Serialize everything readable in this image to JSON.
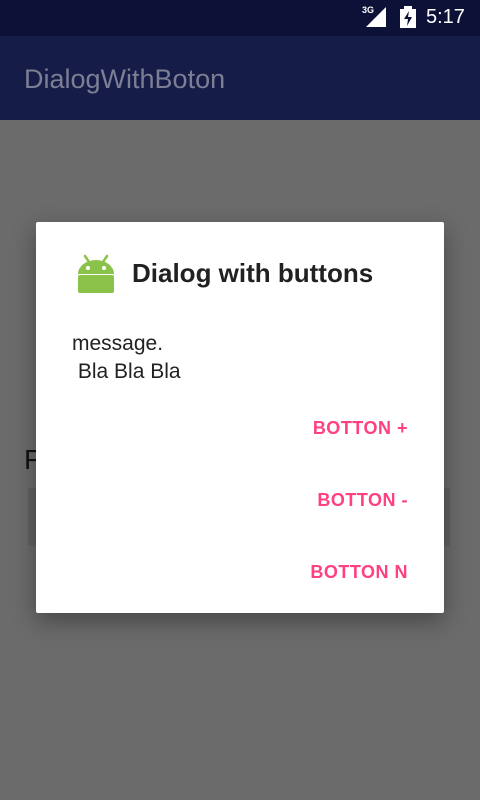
{
  "status_bar": {
    "network": "3G",
    "time": "5:17"
  },
  "app_bar": {
    "title": "DialogWithBoton"
  },
  "background": {
    "partial_label": "F"
  },
  "dialog": {
    "title": "Dialog with buttons",
    "message": "message.\n Bla Bla Bla",
    "buttons": {
      "positive": "BOTTON +",
      "negative": "BOTTON -",
      "neutral": "BOTTON N"
    },
    "icon": "android-robot-icon"
  },
  "colors": {
    "status_bar": "#0d1138",
    "app_bar": "#161c48",
    "scrim": "#6b6b6b",
    "accent": "#ff4081",
    "android_green": "#8bc34a"
  }
}
